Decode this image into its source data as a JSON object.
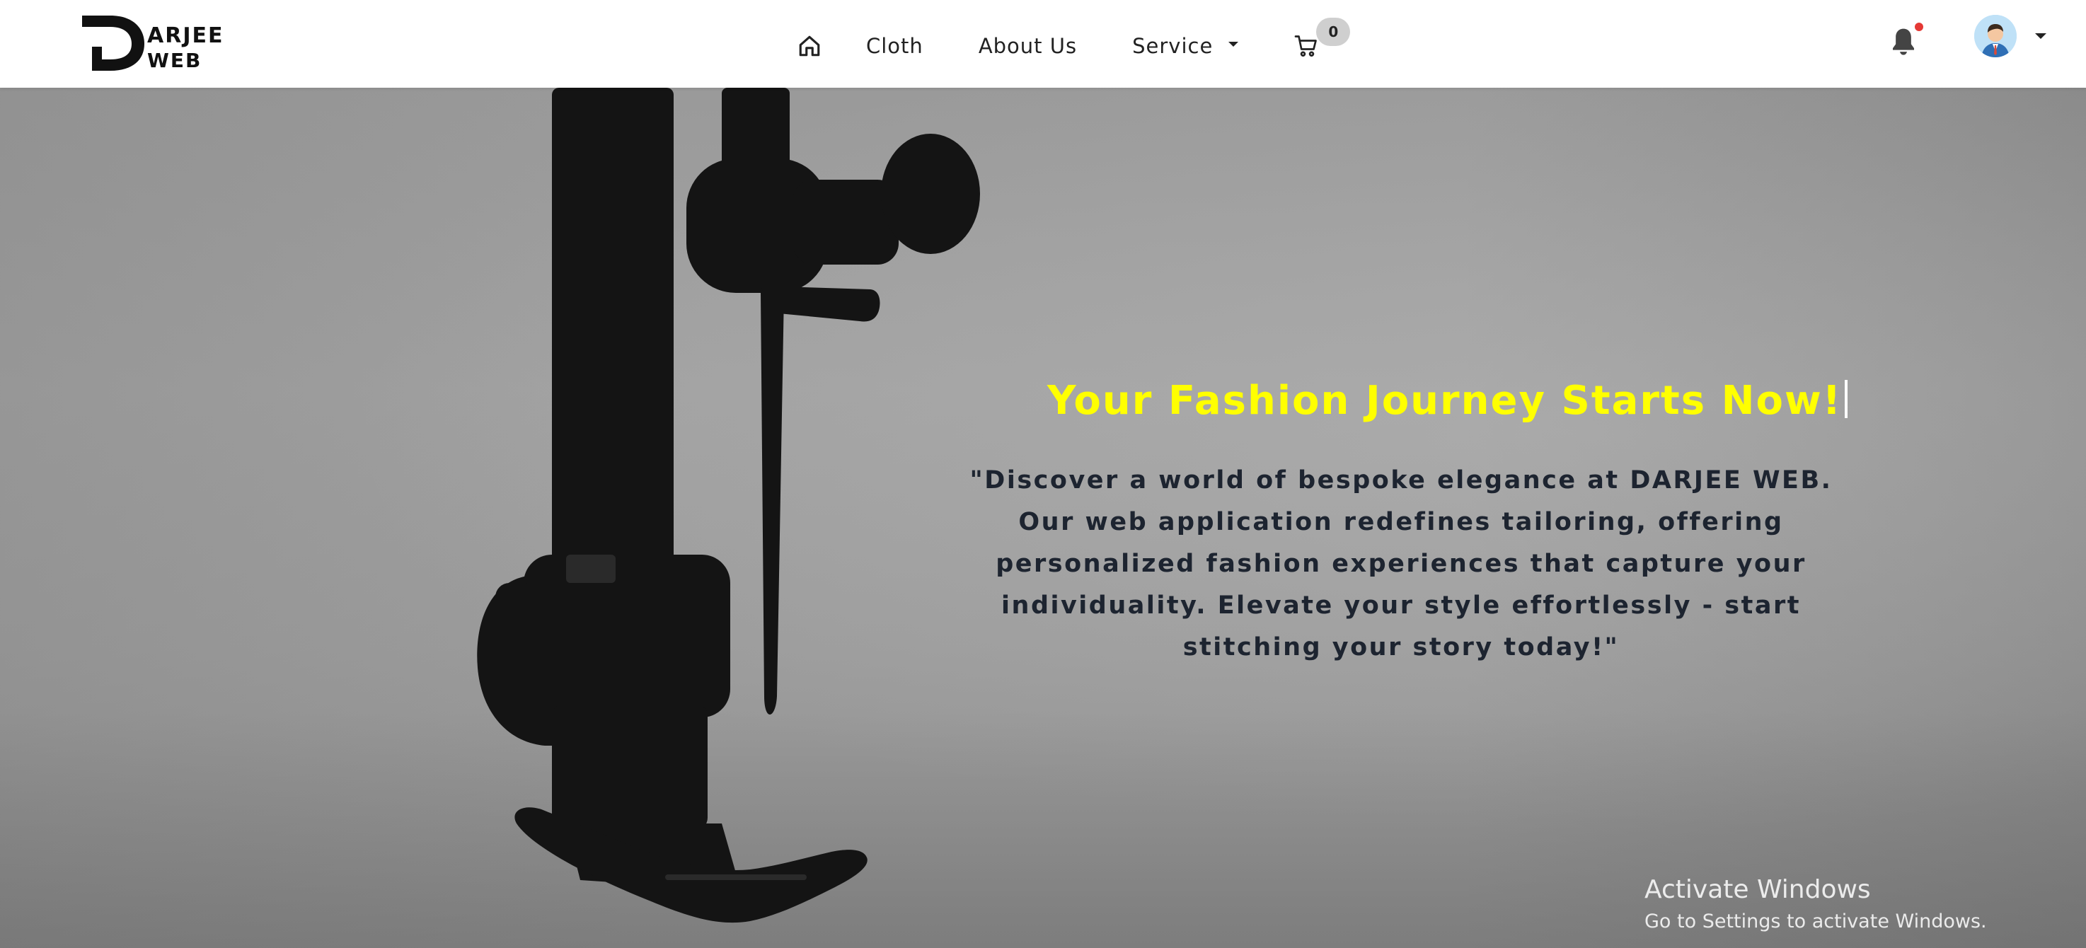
{
  "brand": {
    "logo_line1": "ARJEE",
    "logo_line2": "WEB"
  },
  "nav": {
    "home_icon": "home-icon",
    "links": [
      {
        "label": "Cloth"
      },
      {
        "label": "About Us"
      }
    ],
    "service_label": "Service",
    "cart_icon": "cart-icon",
    "cart_count": "0",
    "notification_icon": "bell-icon",
    "avatar_icon": "user-avatar"
  },
  "hero": {
    "title": "Your Fashion Journey Starts Now!",
    "description": "\"Discover a world of bespoke elegance at DARJEE WEB. Our web application redefines tailoring, offering personalized fashion experiences that capture your individuality. Elevate your style effortlessly - start stitching your story today!\""
  },
  "os_watermark": {
    "title": "Activate Windows",
    "subtitle": "Go to Settings to activate Windows."
  },
  "colors": {
    "title_yellow": "#ffff00",
    "description_text": "#1d2430",
    "badge_bg": "#cfcfcf",
    "notification_dot": "#e53935"
  }
}
